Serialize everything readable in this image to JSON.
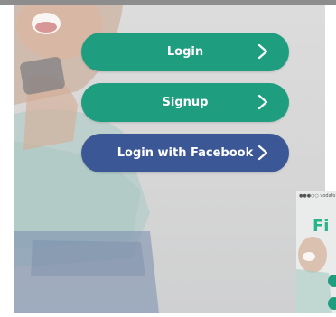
{
  "buttons": {
    "login": "Login",
    "signup": "Signup",
    "facebook": "Login with Facebook"
  },
  "colors": {
    "login_bg": "#1f9e7f",
    "signup_bg": "#1f9e7f",
    "facebook_bg": "#3b5795"
  },
  "preview": {
    "status_text": "●●●○○ vodafo",
    "heading": "Fi"
  }
}
